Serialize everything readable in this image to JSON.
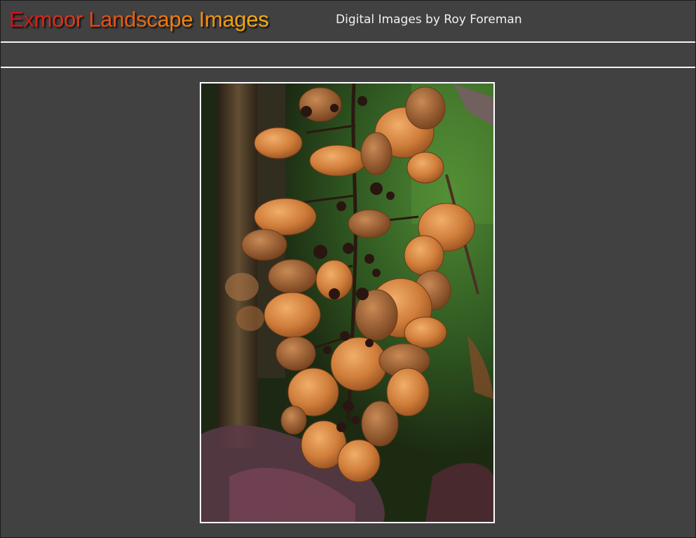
{
  "header": {
    "site_title": "Exmoor Landscape Images",
    "subtitle": "Digital Images by Roy Foreman"
  },
  "main": {
    "photo": {
      "subject": "hydrangea-seedhead-photo",
      "colors": {
        "background_green": "#3f6b2a",
        "petal_orange": "#c9773a",
        "stem_dark": "#2a1a10"
      }
    }
  },
  "theme": {
    "page_background": "#414141",
    "rule_color": "#f4f4f4",
    "subtitle_color": "#f2f2f2"
  }
}
